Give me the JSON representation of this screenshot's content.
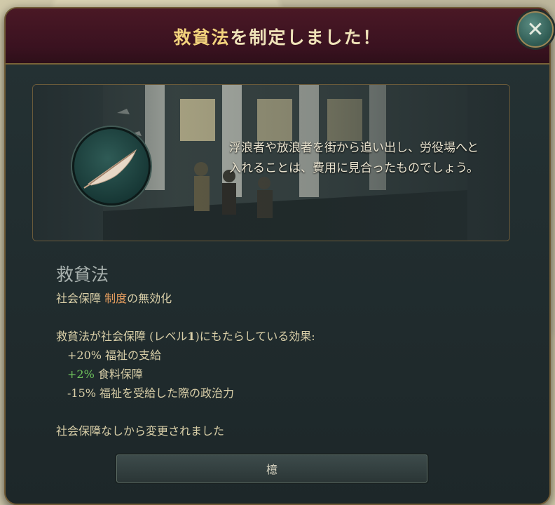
{
  "dialog": {
    "title_law": "救貧法",
    "title_rest": "を制定しました！",
    "close_icon": "close-icon"
  },
  "event": {
    "quote": "浮浪者や放浪者を街から追い出し、労役場へと入れることは、費用に見合ったものでしょう。",
    "medallion_icon": "feather-quill-icon"
  },
  "law": {
    "name": "救貧法",
    "group_line": {
      "prefix": "社会保障 ",
      "highlight": "制度",
      "suffix": "の無効化"
    },
    "effect_header": {
      "text": "救貧法が社会保障 (レベル",
      "level": "1",
      "tail": ")にもたらしている効果:"
    },
    "effects": [
      {
        "value": "+20%",
        "label": " 福祉の支給",
        "color": "default"
      },
      {
        "value": "+2%",
        "label": " 食料保障",
        "color": "green"
      },
      {
        "value": "-15%",
        "label": " 福祉を受給した際の政治力",
        "color": "default"
      }
    ],
    "change_note": "社会保障なしから変更されました"
  },
  "buttons": {
    "ok_label": "檍"
  },
  "colors": {
    "accent_gold": "#f2d27c",
    "highlight_orange": "#e09a5d",
    "positive_green": "#6ec25c"
  }
}
